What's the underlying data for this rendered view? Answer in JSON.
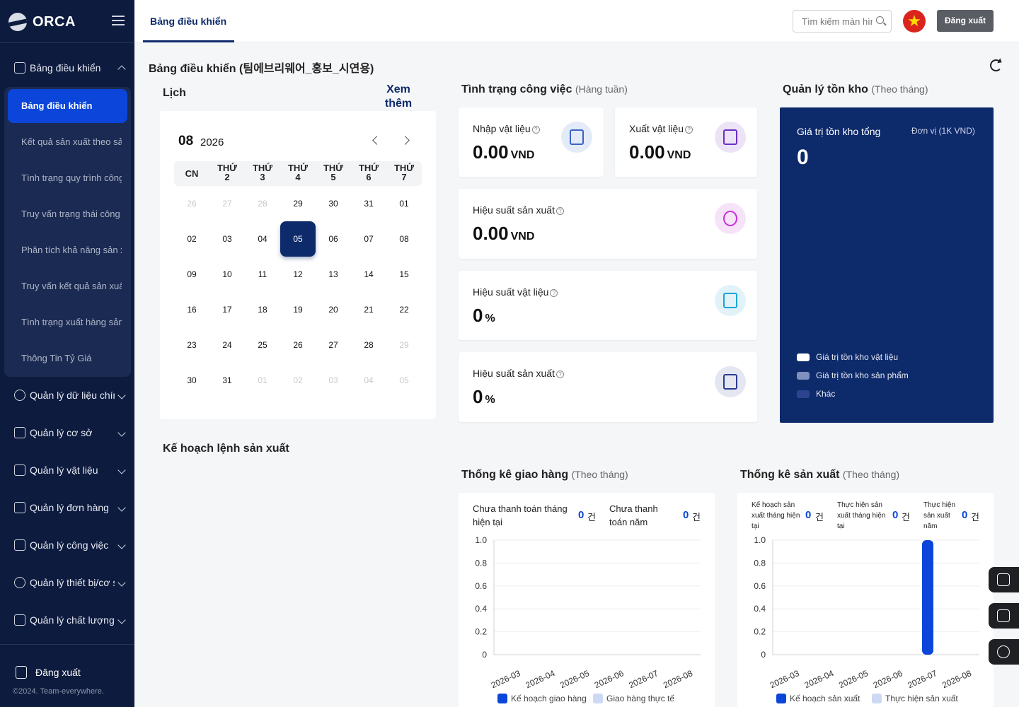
{
  "sidebar": {
    "brand": "ORCA",
    "sections": [
      {
        "label": "Bảng điều khiển",
        "icon": "home-icon",
        "expanded": true
      },
      {
        "label": "Quản lý dữ liệu chính",
        "icon": "user-icon"
      },
      {
        "label": "Quản lý cơ sở",
        "icon": "building-icon"
      },
      {
        "label": "Quản lý vật liệu",
        "icon": "checkbox-icon"
      },
      {
        "label": "Quản lý đơn hàng",
        "icon": "document-icon"
      },
      {
        "label": "Quản lý công việc",
        "icon": "calendar-icon"
      },
      {
        "label": "Quản lý thiết bị/cơ sở",
        "icon": "gear-icon"
      },
      {
        "label": "Quản lý chất lượng",
        "icon": "gift-icon"
      }
    ],
    "submenu": [
      "Bảng điều khiển",
      "Kết quả sản xuất theo sản phẩm",
      "Tình trạng quy trình công việc",
      "Truy vấn trạng thái công việc",
      "Phân tích khả năng sản xuất",
      "Truy vấn kết quả sản xuất",
      "Tình trạng xuất hàng sản phẩm",
      "Thông Tin Tỷ Giá"
    ],
    "logout_label": "Đăng xuất",
    "copyright": "©2024. Team-everywhere."
  },
  "topbar": {
    "tab_label": "Bảng điều khiển",
    "search_placeholder": "Tìm kiếm màn hình",
    "flag_icon": "vietnam-flag-icon",
    "logout_label": "Đăng xuất"
  },
  "page": {
    "title": "Bảng điều khiển (팀에브리웨어_홍보_시연용)"
  },
  "calendar": {
    "section_title": "Lịch",
    "see_more": "Xem thêm",
    "month": "08",
    "year": "2026",
    "weekdays": [
      "CN",
      "THỨ 2",
      "THỨ 3",
      "THỨ 4",
      "THỨ 5",
      "THỨ 6",
      "THỨ 7"
    ],
    "selected_day": "05",
    "weeks": [
      [
        {
          "d": "26",
          "m": true
        },
        {
          "d": "27",
          "m": true
        },
        {
          "d": "28",
          "m": true
        },
        {
          "d": "29"
        },
        {
          "d": "30"
        },
        {
          "d": "31"
        },
        {
          "d": "01"
        }
      ],
      [
        {
          "d": "02"
        },
        {
          "d": "03"
        },
        {
          "d": "04"
        },
        {
          "d": "05",
          "s": true
        },
        {
          "d": "06"
        },
        {
          "d": "07"
        },
        {
          "d": "08"
        }
      ],
      [
        {
          "d": "09"
        },
        {
          "d": "10"
        },
        {
          "d": "11"
        },
        {
          "d": "12"
        },
        {
          "d": "13"
        },
        {
          "d": "14"
        },
        {
          "d": "15"
        }
      ],
      [
        {
          "d": "16"
        },
        {
          "d": "17"
        },
        {
          "d": "18"
        },
        {
          "d": "19"
        },
        {
          "d": "20"
        },
        {
          "d": "21"
        },
        {
          "d": "22"
        }
      ],
      [
        {
          "d": "23"
        },
        {
          "d": "24"
        },
        {
          "d": "25"
        },
        {
          "d": "26"
        },
        {
          "d": "27"
        },
        {
          "d": "28"
        },
        {
          "d": "29",
          "m": true
        }
      ],
      [
        {
          "d": "30"
        },
        {
          "d": "31"
        },
        {
          "d": "01",
          "m": true
        },
        {
          "d": "02",
          "m": true
        },
        {
          "d": "03",
          "m": true
        },
        {
          "d": "04",
          "m": true
        },
        {
          "d": "05",
          "m": true
        }
      ]
    ]
  },
  "work_status": {
    "title": "Tình trạng công việc",
    "subtitle": "(Hàng tuần)",
    "material_in": {
      "label": "Nhập vật liệu",
      "value": "0.00",
      "unit": "VND",
      "icon": "checkbox-icon",
      "icon_color": "#3a63c8",
      "icon_bg": "#e4ebf8"
    },
    "material_out": {
      "label": "Xuất vật liệu",
      "value": "0.00",
      "unit": "VND",
      "icon": "clipboard-icon",
      "icon_color": "#6b2fc7",
      "icon_bg": "#ece3f7"
    },
    "production_perf": {
      "label": "Hiệu suất sản xuất",
      "value": "0.00",
      "unit": "VND",
      "icon": "pie-chart-icon",
      "icon_color": "#c62fd9",
      "icon_bg": "#f6e3f8"
    },
    "material_perf": {
      "label": "Hiệu suất vật liệu",
      "value": "0",
      "unit": "%",
      "icon": "box-icon",
      "icon_color": "#1aa5d6",
      "icon_bg": "#e1f3f9"
    },
    "production_perf_pct": {
      "label": "Hiệu suất sản xuất",
      "value": "0",
      "unit": "%",
      "icon": "truck-icon",
      "icon_color": "#2a3c8e",
      "icon_bg": "#e4e7f2"
    }
  },
  "inventory": {
    "title": "Quản lý tồn kho",
    "subtitle": "(Theo tháng)",
    "total_label": "Giá trị tồn kho tổng",
    "unit_label": "Đơn vị (1K VND)",
    "total_value": "0",
    "legend": [
      {
        "label": "Giá trị tồn kho vật liệu",
        "color": "#ffffff"
      },
      {
        "label": "Giá trị tồn kho sản phẩm",
        "color": "#7f8fbf"
      },
      {
        "label": "Khác",
        "color": "#2d4390"
      }
    ]
  },
  "production_plan": {
    "title": "Kế hoạch lệnh sản xuất"
  },
  "delivery": {
    "title": "Thống kê giao hàng",
    "subtitle": "(Theo tháng)",
    "stats": [
      {
        "label": "Chưa thanh toán tháng hiện tại",
        "value": "0",
        "unit": "건"
      },
      {
        "label": "Chưa thanh toán năm",
        "value": "0",
        "unit": "건"
      }
    ],
    "chart_data": {
      "type": "bar",
      "categories": [
        "2026-03",
        "2026-04",
        "2026-05",
        "2026-06",
        "2026-07",
        "2026-08"
      ],
      "series": [
        {
          "name": "Kế hoạch giao hàng",
          "values": [
            0,
            0,
            0,
            0,
            0,
            0
          ],
          "color": "#0b45d9"
        },
        {
          "name": "Giao hàng thực tế",
          "values": [
            0,
            0,
            0,
            0,
            0,
            0
          ],
          "color": "#cdd8f3"
        }
      ],
      "yticks": [
        "1.0",
        "0.8",
        "0.6",
        "0.4",
        "0.2",
        "0"
      ],
      "ylim": [
        0,
        1.0
      ]
    }
  },
  "production_stats": {
    "title": "Thống kê sản xuất",
    "subtitle": "(Theo tháng)",
    "stats": [
      {
        "label": "Kế hoạch sản xuất tháng hiện tại",
        "value": "0",
        "unit": "건"
      },
      {
        "label": "Thực hiện sản xuất tháng hiện tại",
        "value": "0",
        "unit": "건"
      },
      {
        "label": "Thực hiện sản xuất năm",
        "value": "0",
        "unit": "건"
      }
    ],
    "chart_data": {
      "type": "bar",
      "categories": [
        "2026-03",
        "2026-04",
        "2026-05",
        "2026-06",
        "2026-07",
        "2026-08"
      ],
      "series": [
        {
          "name": "Kế hoạch sản xuất",
          "values": [
            0,
            0,
            0,
            0,
            1.0,
            0
          ],
          "color": "#0b45d9"
        },
        {
          "name": "Thực hiện sản xuất",
          "values": [
            0,
            0,
            0,
            0,
            0,
            0
          ],
          "color": "#cdd8f3"
        }
      ],
      "yticks": [
        "1.0",
        "0.8",
        "0.6",
        "0.4",
        "0.2",
        "0"
      ],
      "ylim": [
        0,
        1.0
      ]
    }
  }
}
